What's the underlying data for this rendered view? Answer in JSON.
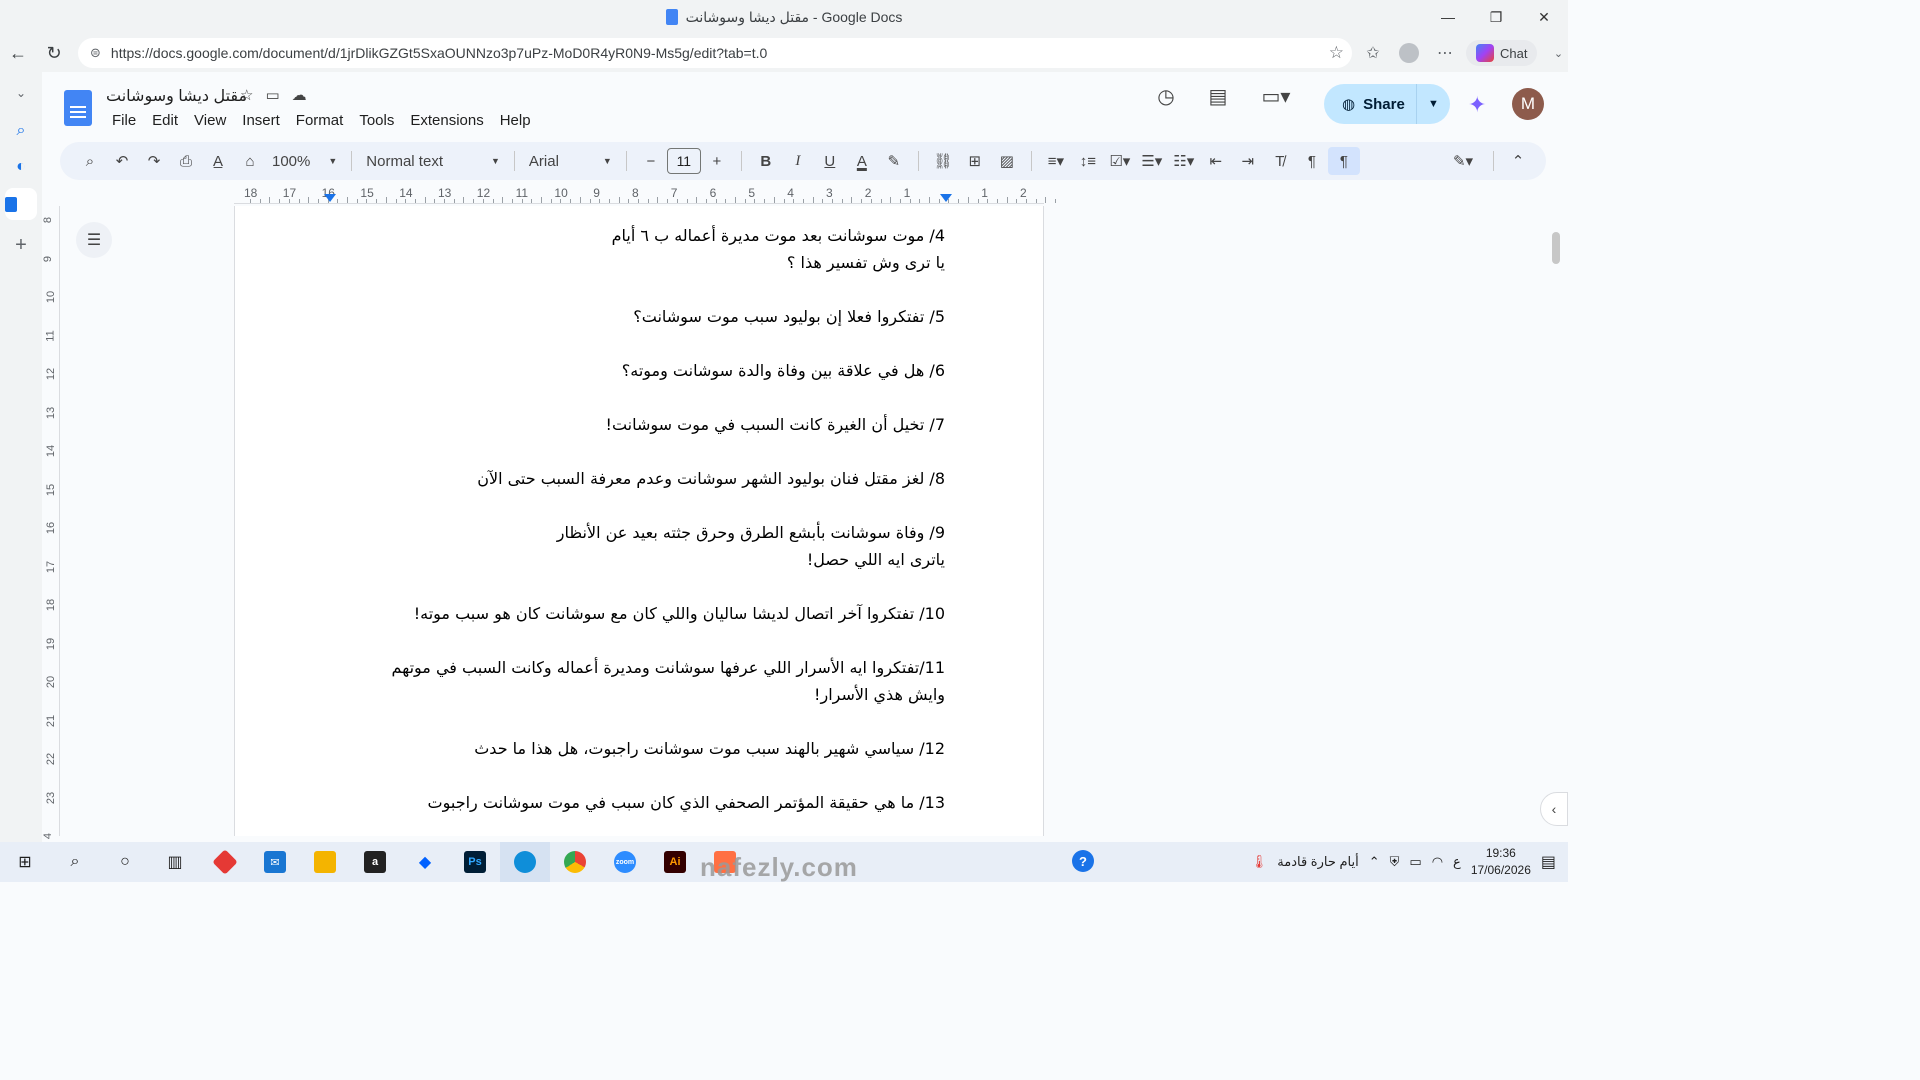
{
  "window": {
    "title": "مقتل ديشا وسوشانت - Google Docs",
    "minimize": "—",
    "maximize": "❐",
    "close": "✕"
  },
  "browser": {
    "url": "https://docs.google.com/document/d/1jrDlikGZGt5SxaOUNNzo3p7uPz-MoD0R4yR0N9-Ms5g/edit?tab=t.0",
    "chat_label": "Chat"
  },
  "doc": {
    "title": "مقتل ديشا وسوشانت",
    "menus": [
      "File",
      "Edit",
      "View",
      "Insert",
      "Format",
      "Tools",
      "Extensions",
      "Help"
    ],
    "share_label": "Share",
    "avatar_letter": "M"
  },
  "toolbar": {
    "zoom": "100%",
    "style": "Normal text",
    "font": "Arial",
    "font_size": "11"
  },
  "ruler": {
    "numbers": [
      "18",
      "17",
      "16",
      "15",
      "14",
      "13",
      "12",
      "11",
      "10",
      "9",
      "8",
      "7",
      "6",
      "5",
      "4",
      "3",
      "2",
      "1",
      "",
      "1",
      "2"
    ],
    "vertical_numbers": [
      "8",
      "9",
      "10",
      "11",
      "12",
      "13",
      "14",
      "15",
      "16",
      "17",
      "18",
      "19",
      "20",
      "21",
      "22",
      "23",
      "4"
    ]
  },
  "content": {
    "paragraphs": [
      {
        "lines": [
          "4/ موت سوشانت بعد موت مديرة أعماله ب ٦ أيام",
          "يا ترى وش تفسير  هذا ؟"
        ]
      },
      {
        "lines": [
          "5/ تفتكروا فعلا إن بوليود سبب موت سوشانت؟"
        ]
      },
      {
        "lines": [
          "6/ هل في علاقة بين وفاة والدة سوشانت وموته؟"
        ]
      },
      {
        "lines": [
          "7/ تخيل أن الغيرة كانت السبب في موت سوشانت!"
        ]
      },
      {
        "lines": [
          "8/ لغز مقتل فنان بوليود الشهر سوشانت وعدم معرفة السبب حتى الآن"
        ]
      },
      {
        "lines": [
          "9/ وفاة سوشانت بأبشع الطرق وحرق جثته بعيد عن الأنظار",
          "ياترى ايه اللي حصل!"
        ]
      },
      {
        "lines": [
          "10/  تفتكروا آخر اتصال لديشا ساليان واللي كان مع سوشانت كان هو سبب موته!"
        ]
      },
      {
        "lines": [
          "11/تفتكروا ايه الأسرار  اللي عرفها سوشانت ومديرة أعماله وكانت السبب في موتهم",
          "وايش هذي الأسرار!"
        ]
      },
      {
        "lines": [
          "12/ سياسي شهير بالهند سبب موت سوشانت راجبوت، هل هذا ما حدث"
        ]
      },
      {
        "lines": [
          "13/ ما هي حقيقة المؤتمر الصحفي الذي كان سبب في موت سوشانت راجبوت"
        ]
      }
    ]
  },
  "taskbar": {
    "weather_text": "أيام حارة قادمة",
    "lang": "ع",
    "time": "19:36",
    "date": "17/06/2026"
  },
  "watermark": "nafezly.com"
}
